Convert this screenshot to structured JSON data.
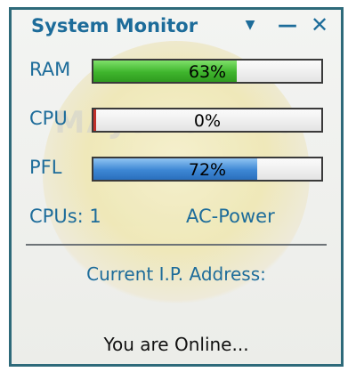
{
  "window": {
    "title": "System Monitor",
    "menu_icon": "dropdown-triangle-icon",
    "minimize_icon": "minimize-icon",
    "close_icon": "close-icon",
    "minimize_glyph": "—",
    "close_glyph": "✕",
    "menu_glyph": "▼"
  },
  "meters": [
    {
      "label": "RAM",
      "value_text": "63%",
      "percent": 63,
      "color": "#3fb52d"
    },
    {
      "label": "CPU",
      "value_text": "0%",
      "percent": 0,
      "color": "#c0302a"
    },
    {
      "label": "PFL",
      "value_text": "72%",
      "percent": 72,
      "color": "#3d87d4"
    }
  ],
  "info": {
    "cpus": "CPUs: 1",
    "power": "AC-Power"
  },
  "network": {
    "ip_label": "Current I.P. Address:",
    "status": "You are Online..."
  },
  "watermark": {
    "text": "MAJORGEEKS"
  },
  "colors": {
    "text_accent": "#1d6c9a",
    "border": "#2e6a7a"
  }
}
